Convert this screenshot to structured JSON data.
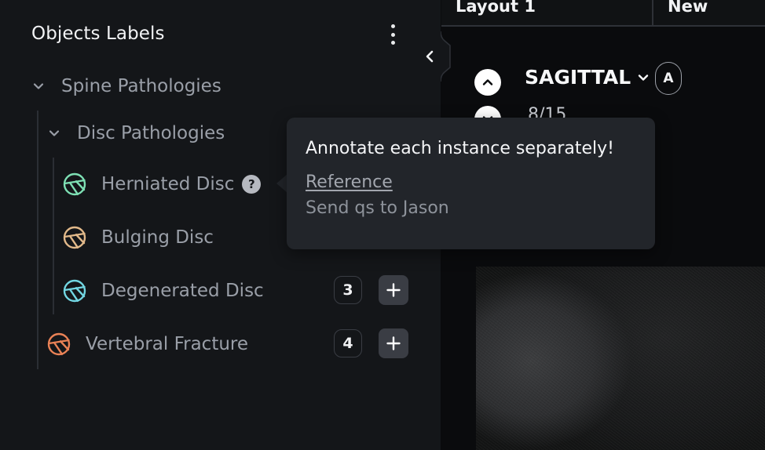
{
  "panel": {
    "title": "Objects Labels",
    "menu_icon": "kebab-menu-icon"
  },
  "tree": {
    "group": {
      "label": "Spine Pathologies",
      "expanded": true
    },
    "subgroup": {
      "label": "Disc Pathologies",
      "expanded": true
    },
    "items": [
      {
        "label": "Herniated Disc",
        "color": "#7ee0b4",
        "help": "?"
      },
      {
        "label": "Bulging Disc",
        "color": "#e2b98a"
      },
      {
        "label": "Degenerated Disc",
        "color": "#72d6e2",
        "count": "3"
      },
      {
        "label": "Vertebral Fracture",
        "color": "#ea8256",
        "count": "4"
      }
    ]
  },
  "tooltip": {
    "text": "Annotate each instance separately!",
    "link": "Reference",
    "note": "Send qs to Jason"
  },
  "viewer": {
    "tabs": [
      "Layout 1",
      "New"
    ],
    "view_name": "SAGITTAL",
    "orientation": "A",
    "slice_counter": "8/15"
  }
}
